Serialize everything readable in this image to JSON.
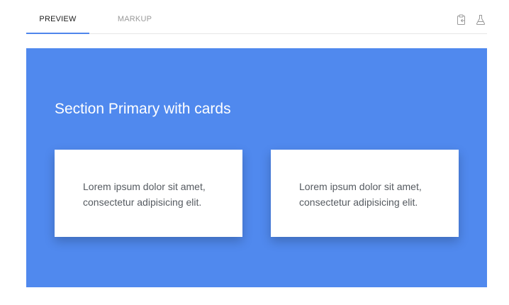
{
  "tabs": [
    {
      "label": "PREVIEW",
      "active": true
    },
    {
      "label": "MARKUP",
      "active": false
    }
  ],
  "toolbar": {
    "icons": [
      "clipboard-icon",
      "flask-icon"
    ]
  },
  "section": {
    "title": "Section Primary with cards",
    "background": "#5089ee",
    "cards": [
      {
        "text": "Lorem ipsum dolor sit amet, consectetur adipisicing elit."
      },
      {
        "text": "Lorem ipsum dolor sit amet, consectetur adipisicing elit."
      }
    ]
  },
  "colors": {
    "accent": "#4f86ec",
    "tab_active": "#222222",
    "tab_inactive": "#9a9a9a",
    "card_text": "#555a60"
  }
}
